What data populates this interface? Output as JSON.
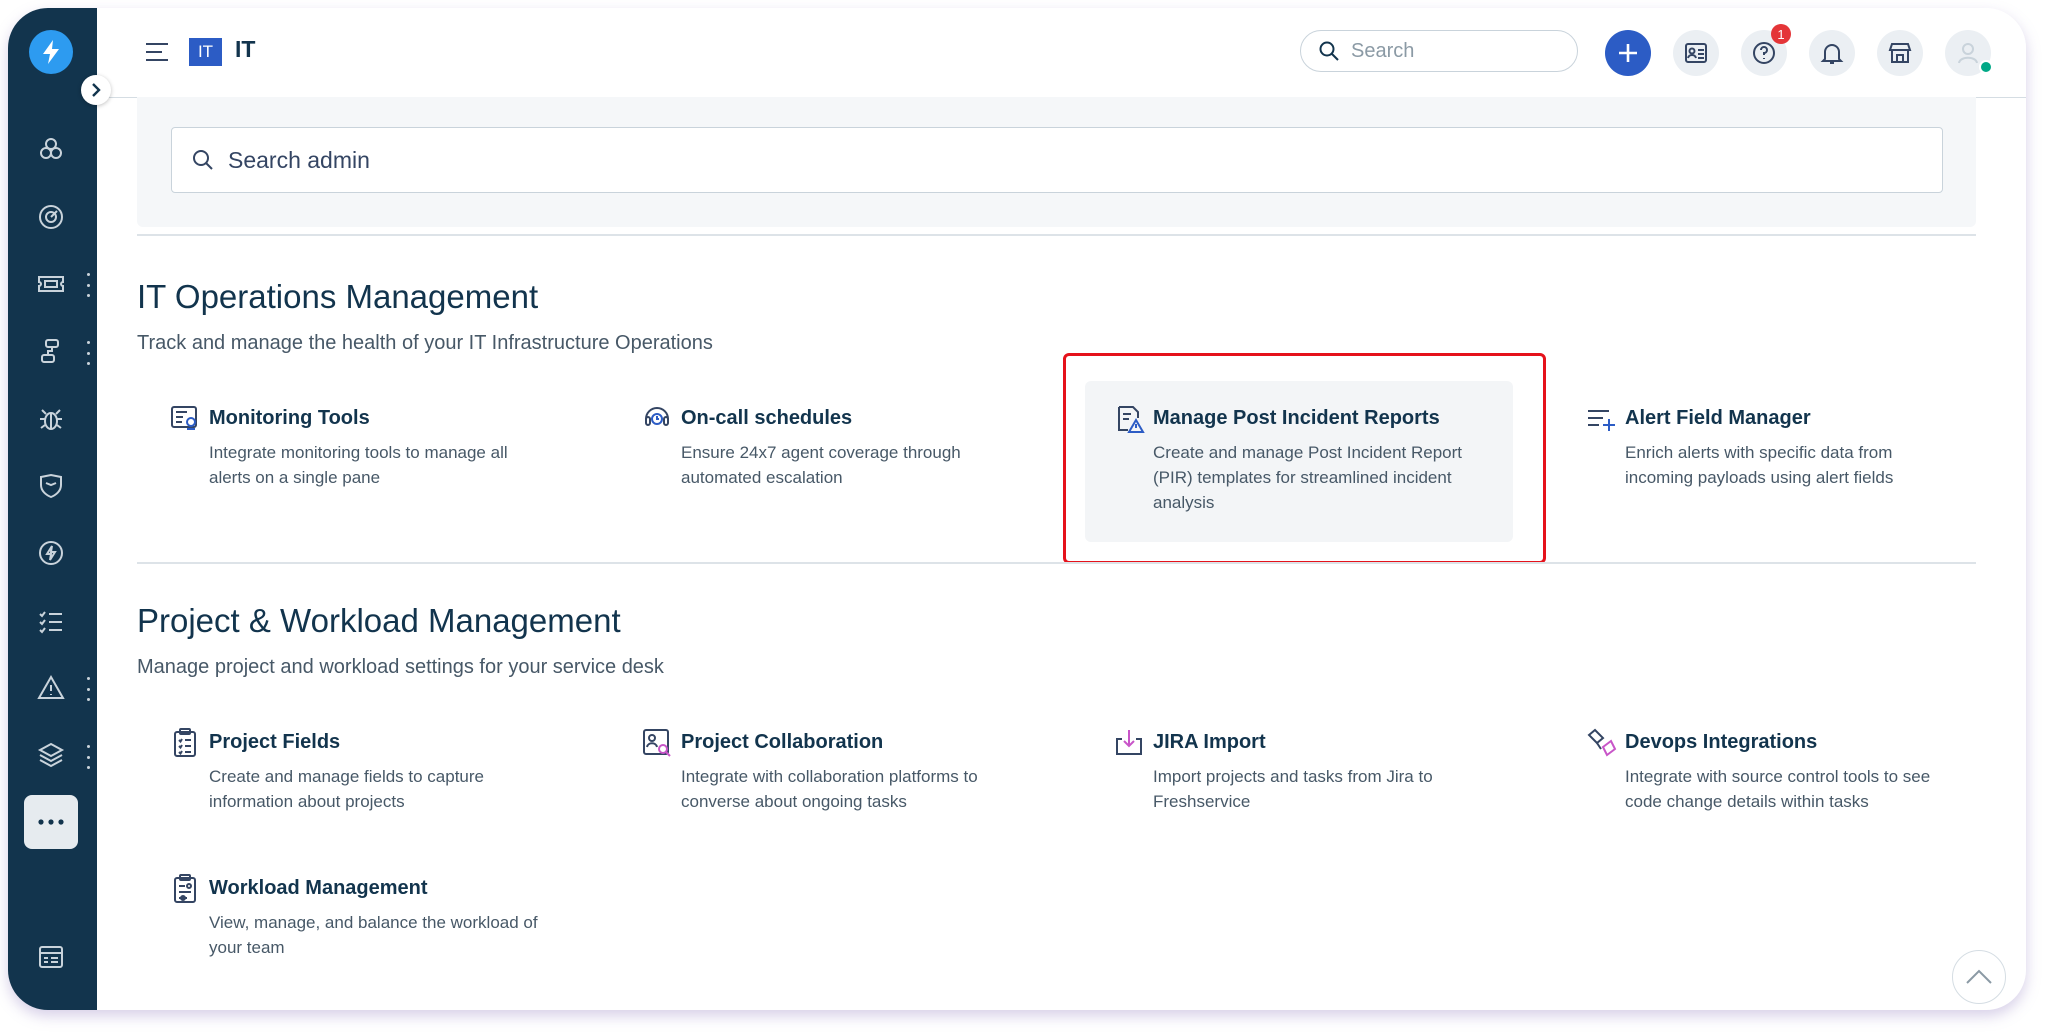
{
  "header": {
    "workspace_badge": "IT",
    "workspace_name": "IT",
    "search_placeholder": "Search",
    "help_badge_count": "1"
  },
  "admin_search": {
    "placeholder": "Search admin"
  },
  "sections": [
    {
      "title": "IT Operations Management",
      "subtitle": "Track and manage the health of your IT Infrastructure Operations",
      "cards": [
        {
          "title": "Monitoring Tools",
          "description": "Integrate monitoring tools to manage all alerts on a single pane",
          "icon": "monitor-icon"
        },
        {
          "title": "On-call schedules",
          "description": "Ensure 24x7 agent coverage through automated escalation",
          "icon": "on-call-icon"
        },
        {
          "title": "Manage Post Incident Reports",
          "description": "Create and manage Post Incident Report (PIR) templates for streamlined incident analysis",
          "icon": "post-incident-report-icon"
        },
        {
          "title": "Alert Field Manager",
          "description": "Enrich alerts with specific data from incoming payloads using alert fields",
          "icon": "alert-field-icon"
        }
      ]
    },
    {
      "title": "Project & Workload Management",
      "subtitle": "Manage project and workload settings for your service desk",
      "cards": [
        {
          "title": "Project Fields",
          "description": "Create and manage fields to capture information about projects",
          "icon": "clipboard-list-icon"
        },
        {
          "title": "Project Collaboration",
          "description": "Integrate with collaboration platforms to converse about ongoing tasks",
          "icon": "collaboration-icon"
        },
        {
          "title": "JIRA Import",
          "description": "Import projects and tasks from Jira to Freshservice",
          "icon": "import-icon"
        },
        {
          "title": "Devops Integrations",
          "description": "Integrate with source control tools to see code change details within tasks",
          "icon": "devops-icon"
        },
        {
          "title": "Workload Management",
          "description": "View, manage, and balance the workload of your team",
          "icon": "workload-icon"
        }
      ]
    }
  ],
  "colors": {
    "sidebar": "#12344d",
    "accent": "#2c5cc5",
    "highlight_border": "#e5121b",
    "badge": "#e43538",
    "online": "#00a886"
  }
}
